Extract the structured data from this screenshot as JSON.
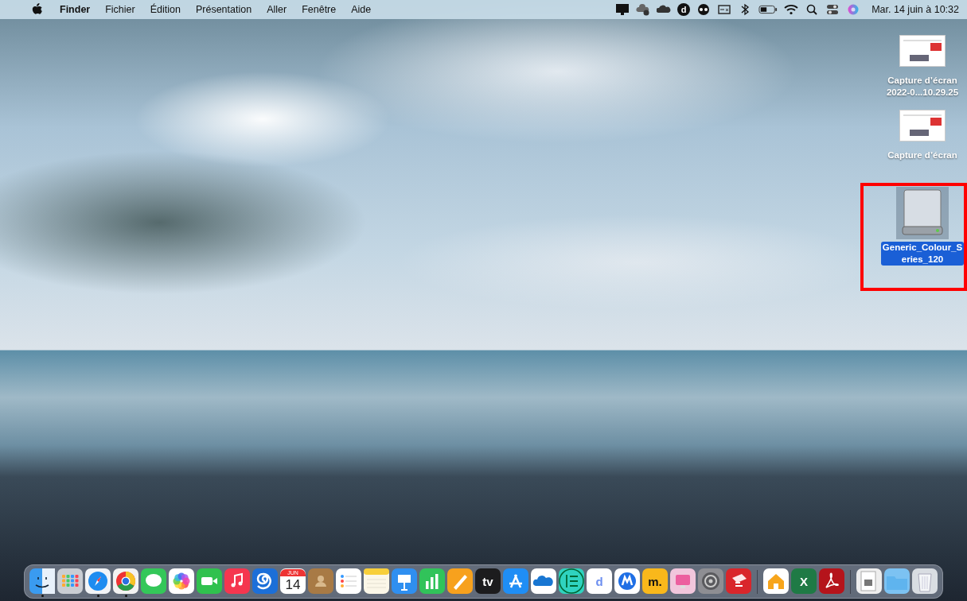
{
  "menu_bar": {
    "app_name": "Finder",
    "menus": [
      "Fichier",
      "Édition",
      "Présentation",
      "Aller",
      "Fenêtre",
      "Aide"
    ],
    "status_letter": "d",
    "clock": "Mar. 14 juin à 10:32"
  },
  "desktop_icons": [
    {
      "kind": "screenshot",
      "lines": [
        "Capture d’écran",
        "2022-0...10.29.25"
      ],
      "selected": false
    },
    {
      "kind": "screenshot",
      "lines": [
        "Capture d’écran"
      ],
      "selected": false
    },
    {
      "kind": "drive",
      "lines": [
        "Generic_Colour_S",
        "eries_120"
      ],
      "selected": true
    }
  ],
  "dock": [
    {
      "kind": "finder",
      "color": "#3a9bf0",
      "running": true
    },
    {
      "kind": "grid",
      "color": "#c9cdd3",
      "running": false
    },
    {
      "kind": "compass",
      "color": "#f2f4f7",
      "running": true
    },
    {
      "kind": "ring",
      "color": "#f2f2f2",
      "running": true
    },
    {
      "kind": "bubble",
      "color": "#34c759",
      "running": false
    },
    {
      "kind": "flower",
      "color": "#ffffff",
      "running": false
    },
    {
      "kind": "camera",
      "color": "#30c14e",
      "running": false
    },
    {
      "kind": "note",
      "color": "#f5364f",
      "running": false
    },
    {
      "kind": "swirl",
      "color": "#1c6fd8",
      "running": false
    },
    {
      "kind": "calendar",
      "color": "#ffffff",
      "month": "JUN",
      "day": "14",
      "running": false
    },
    {
      "kind": "person",
      "color": "#a87a45",
      "running": false
    },
    {
      "kind": "list",
      "color": "#ffffff",
      "running": false
    },
    {
      "kind": "pad",
      "color": "#fbf7e8",
      "running": false
    },
    {
      "kind": "podium",
      "color": "#2f8ff0",
      "running": false
    },
    {
      "kind": "bars",
      "color": "#31c35a",
      "running": false
    },
    {
      "kind": "pen",
      "color": "#f7a11d",
      "running": false
    },
    {
      "kind": "letter",
      "color": "#1c1c1e",
      "glyph": "tv",
      "running": false
    },
    {
      "kind": "store",
      "color": "#1f8ef5",
      "running": false
    },
    {
      "kind": "cloud",
      "color": "#ffffff",
      "running": false
    },
    {
      "kind": "circuit",
      "color": "#2fd3bf",
      "running": false
    },
    {
      "kind": "letter",
      "color": "#ffffff",
      "glyph": "d",
      "running": false
    },
    {
      "kind": "shield",
      "color": "#ffffff",
      "running": false
    },
    {
      "kind": "letter",
      "color": "#f9b81b",
      "glyph": "m.",
      "running": false
    },
    {
      "kind": "monitor",
      "color": "#f1c6dc",
      "running": false
    },
    {
      "kind": "gear",
      "color": "#8e8e93",
      "running": false
    },
    {
      "kind": "cube",
      "color": "#d9262b",
      "running": false
    },
    {
      "kind": "separator"
    },
    {
      "kind": "house",
      "color": "#ffffff",
      "running": false
    },
    {
      "kind": "letter",
      "color": "#1f7a45",
      "glyph": "X",
      "running": false
    },
    {
      "kind": "acrobat",
      "color": "#b5141b",
      "running": false
    },
    {
      "kind": "separator"
    },
    {
      "kind": "file",
      "color": "#eeeeee",
      "running": false
    },
    {
      "kind": "folder",
      "color": "#7cc2f2",
      "running": false
    },
    {
      "kind": "trash",
      "color": "#d9dde2",
      "running": false
    }
  ]
}
